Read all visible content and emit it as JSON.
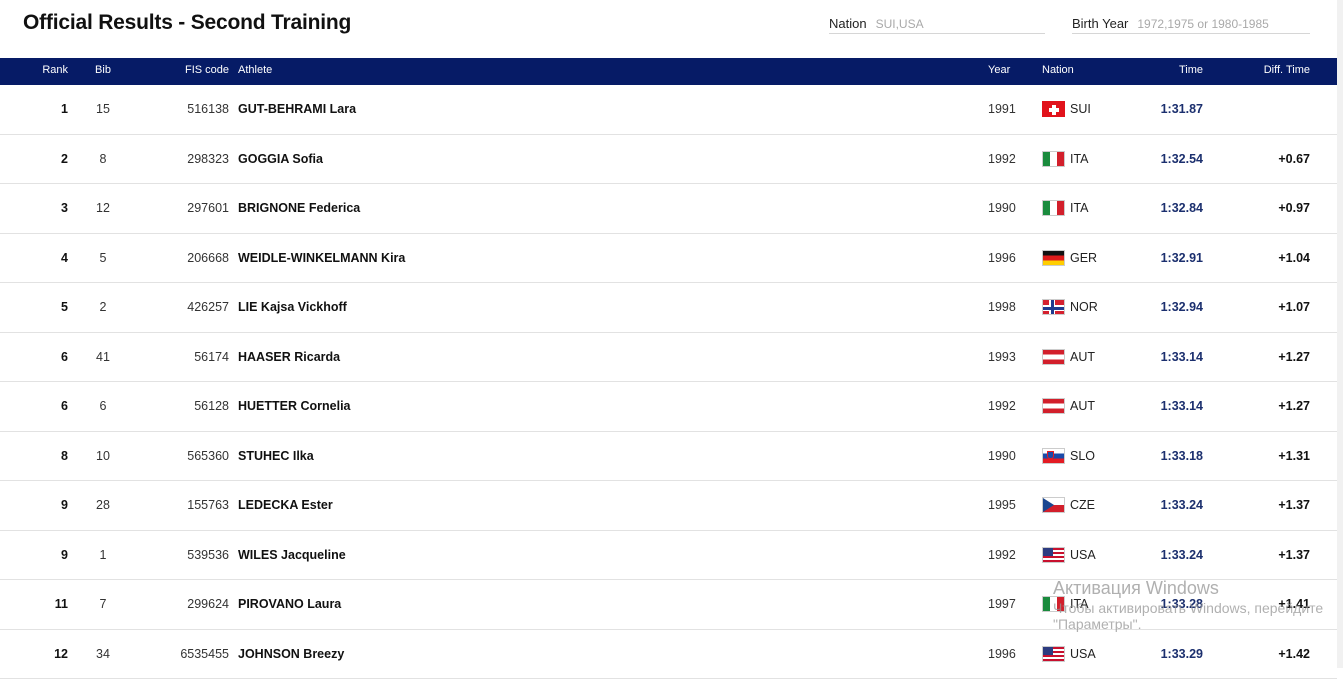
{
  "header": {
    "title": "Official Results - Second Training",
    "nation_filter": {
      "label": "Nation",
      "placeholder": "SUI,USA"
    },
    "birth_year_filter": {
      "label": "Birth Year",
      "placeholder": "1972,1975 or 1980-1985"
    }
  },
  "table": {
    "columns": {
      "rank": "Rank",
      "bib": "Bib",
      "fis": "FIS code",
      "athlete": "Athlete",
      "year": "Year",
      "nation": "Nation",
      "time": "Time",
      "diff": "Diff. Time"
    },
    "rows": [
      {
        "rank": "1",
        "bib": "15",
        "fis": "516138",
        "athlete": "GUT-BEHRAMI Lara",
        "year": "1991",
        "nation": "SUI",
        "time": "1:31.87",
        "diff": ""
      },
      {
        "rank": "2",
        "bib": "8",
        "fis": "298323",
        "athlete": "GOGGIA Sofia",
        "year": "1992",
        "nation": "ITA",
        "time": "1:32.54",
        "diff": "+0.67"
      },
      {
        "rank": "3",
        "bib": "12",
        "fis": "297601",
        "athlete": "BRIGNONE Federica",
        "year": "1990",
        "nation": "ITA",
        "time": "1:32.84",
        "diff": "+0.97"
      },
      {
        "rank": "4",
        "bib": "5",
        "fis": "206668",
        "athlete": "WEIDLE-WINKELMANN Kira",
        "year": "1996",
        "nation": "GER",
        "time": "1:32.91",
        "diff": "+1.04"
      },
      {
        "rank": "5",
        "bib": "2",
        "fis": "426257",
        "athlete": "LIE Kajsa Vickhoff",
        "year": "1998",
        "nation": "NOR",
        "time": "1:32.94",
        "diff": "+1.07"
      },
      {
        "rank": "6",
        "bib": "41",
        "fis": "56174",
        "athlete": "HAASER Ricarda",
        "year": "1993",
        "nation": "AUT",
        "time": "1:33.14",
        "diff": "+1.27"
      },
      {
        "rank": "6",
        "bib": "6",
        "fis": "56128",
        "athlete": "HUETTER Cornelia",
        "year": "1992",
        "nation": "AUT",
        "time": "1:33.14",
        "diff": "+1.27"
      },
      {
        "rank": "8",
        "bib": "10",
        "fis": "565360",
        "athlete": "STUHEC Ilka",
        "year": "1990",
        "nation": "SLO",
        "time": "1:33.18",
        "diff": "+1.31"
      },
      {
        "rank": "9",
        "bib": "28",
        "fis": "155763",
        "athlete": "LEDECKA Ester",
        "year": "1995",
        "nation": "CZE",
        "time": "1:33.24",
        "diff": "+1.37"
      },
      {
        "rank": "9",
        "bib": "1",
        "fis": "539536",
        "athlete": "WILES Jacqueline",
        "year": "1992",
        "nation": "USA",
        "time": "1:33.24",
        "diff": "+1.37"
      },
      {
        "rank": "11",
        "bib": "7",
        "fis": "299624",
        "athlete": "PIROVANO Laura",
        "year": "1997",
        "nation": "ITA",
        "time": "1:33.28",
        "diff": "+1.41"
      },
      {
        "rank": "12",
        "bib": "34",
        "fis": "6535455",
        "athlete": "JOHNSON Breezy",
        "year": "1996",
        "nation": "USA",
        "time": "1:33.29",
        "diff": "+1.42"
      }
    ]
  },
  "watermark": {
    "line1": "Активация Windows",
    "line2": "Чтобы активировать Windows, перейдите",
    "line3": "\"Параметры\"."
  },
  "colors": {
    "header_bg": "#061b66",
    "time_text": "#1b2f6e"
  }
}
